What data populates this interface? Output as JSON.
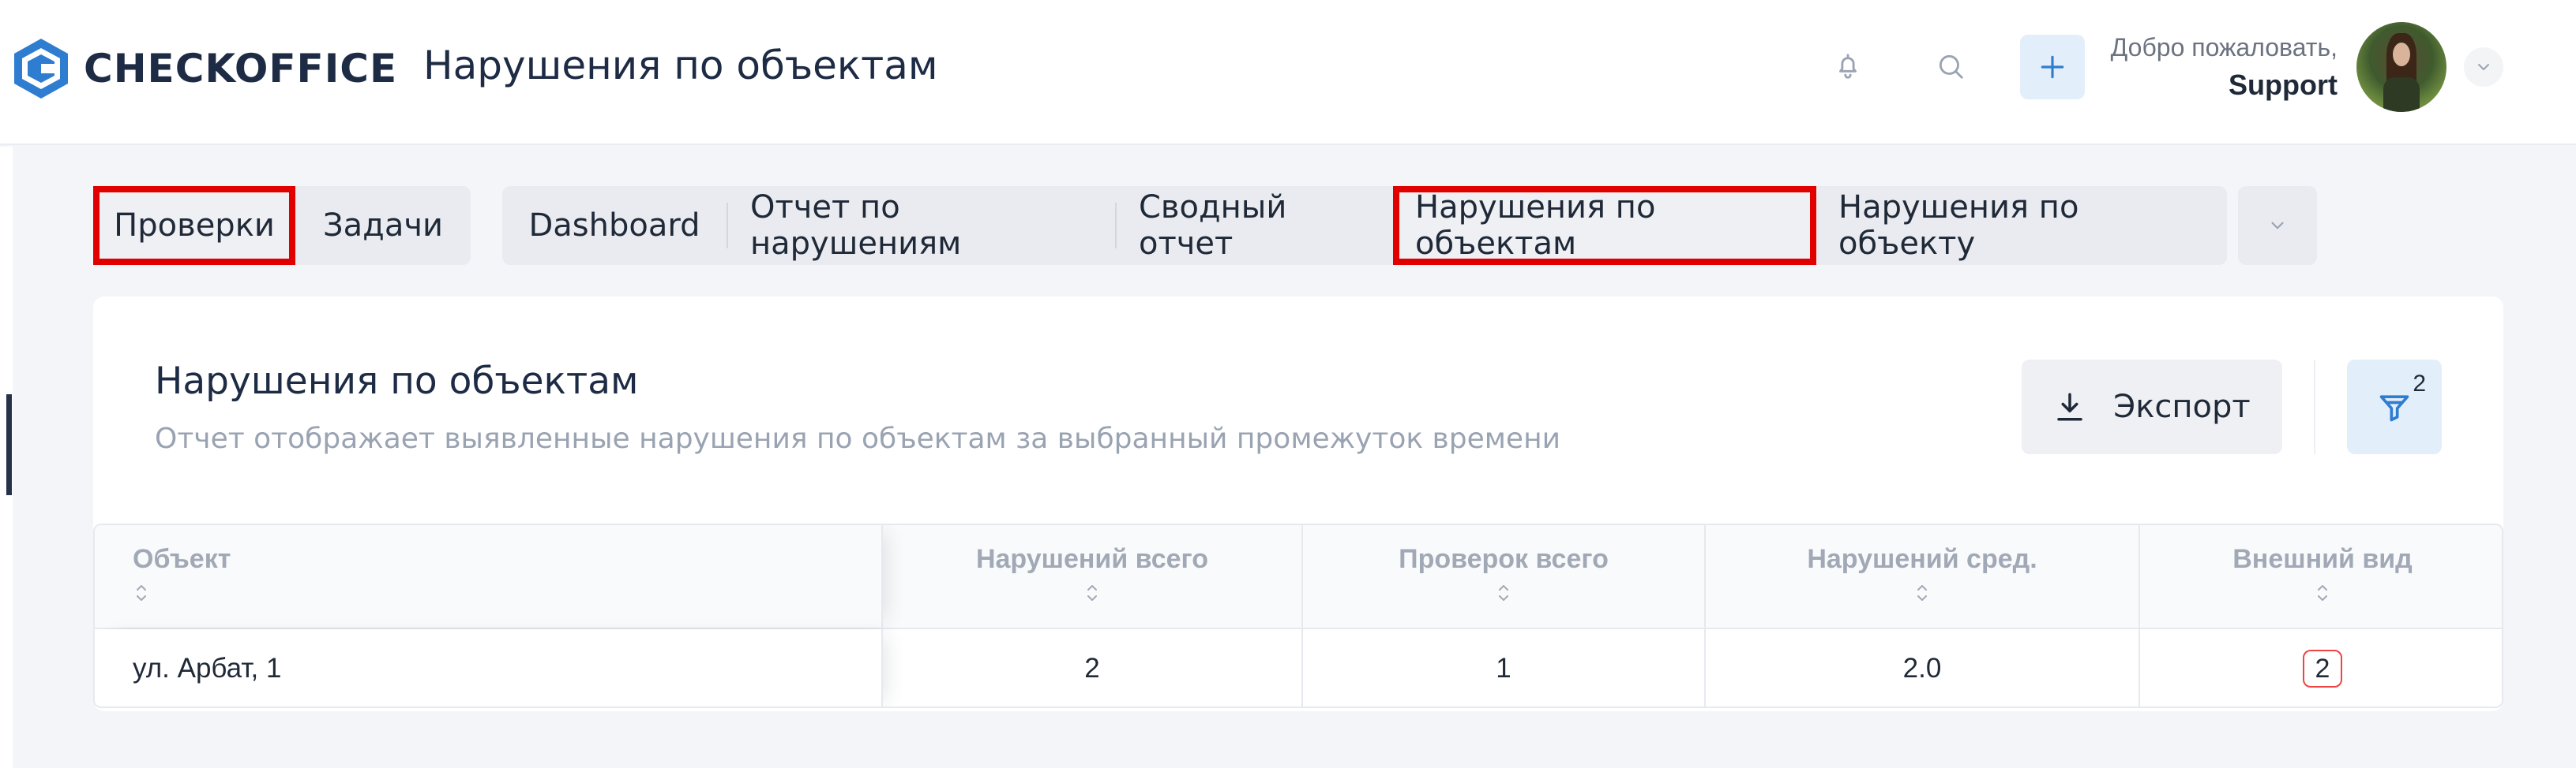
{
  "brand": {
    "name": "CHECKOFFICE"
  },
  "header": {
    "title": "Нарушения по объектам",
    "welcome": "Добро пожаловать,",
    "user": "Support"
  },
  "tabs": {
    "group_a": [
      {
        "label": "Проверки",
        "highlighted": true
      },
      {
        "label": "Задачи",
        "highlighted": false
      }
    ],
    "group_b": [
      {
        "label": "Dashboard",
        "highlighted": false
      },
      {
        "label": "Отчет по нарушениям",
        "highlighted": false
      },
      {
        "label": "Сводный отчет",
        "highlighted": false
      },
      {
        "label": "Нарушения по объектам",
        "highlighted": true
      },
      {
        "label": "Нарушения по объекту",
        "highlighted": false
      }
    ]
  },
  "card": {
    "title": "Нарушения по объектам",
    "subtitle": "Отчет отображает выявленные нарушения по объектам за выбранный промежуток времени",
    "export_label": "Экспорт",
    "filter_count": "2"
  },
  "table": {
    "columns": [
      "Объект",
      "Нарушений всего",
      "Проверок всего",
      "Нарушений сред.",
      "Внешний вид"
    ],
    "rows": [
      [
        "ул. Арбат, 1",
        "2",
        "1",
        "2.0",
        "2"
      ]
    ]
  },
  "colors": {
    "highlight": "#e00000",
    "brand_blue": "#2f7dd1",
    "text_dark": "#1e2b45",
    "badge_border": "#e44444"
  },
  "icons": [
    "logo-hexagon-icon",
    "bell-icon",
    "search-icon",
    "plus-icon",
    "chevron-down-icon",
    "download-icon",
    "filter-icon",
    "sort-icon"
  ]
}
